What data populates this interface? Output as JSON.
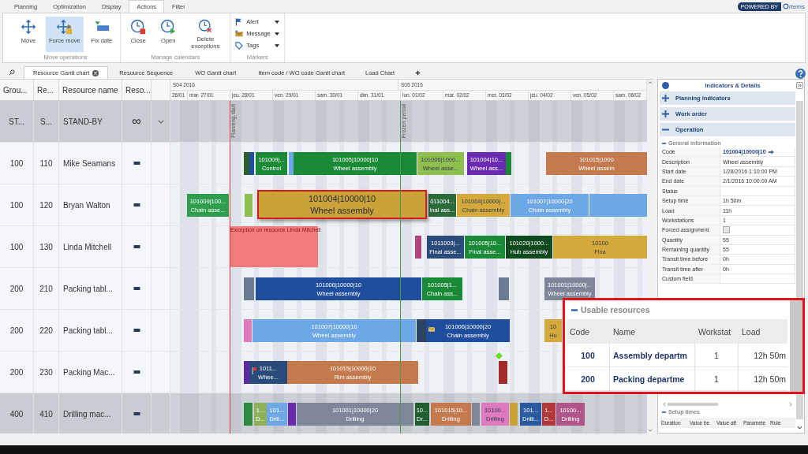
{
  "ribbon_tabs": [
    {
      "label": "Planning",
      "selected": false
    },
    {
      "label": "Optimization",
      "selected": false
    },
    {
      "label": "Display",
      "selected": false
    },
    {
      "label": "Actions",
      "selected": true
    },
    {
      "label": "Filter",
      "selected": false
    }
  ],
  "brand": {
    "tagline": "POWERED BY",
    "name": "rtems"
  },
  "ribbon_groups": [
    {
      "title": "Move operations",
      "kind": "large",
      "buttons": [
        {
          "label": "Move",
          "selected": false
        },
        {
          "label": "Force move",
          "selected": true
        },
        {
          "label": "Fix date",
          "selected": false
        }
      ]
    },
    {
      "title": "Manage calendars",
      "kind": "large",
      "buttons": [
        {
          "label": "Close",
          "selected": false
        },
        {
          "label": "Open",
          "selected": false
        },
        {
          "label": "Delete exceptions",
          "selected": false
        }
      ]
    },
    {
      "title": "Markers",
      "kind": "small",
      "buttons": [
        {
          "label": "Alert"
        },
        {
          "label": "Message"
        },
        {
          "label": "Tags"
        }
      ]
    }
  ],
  "doc_tabs": [
    {
      "label": "Resource Gantt chart",
      "selected": true
    },
    {
      "label": "Resource Sequence",
      "selected": false
    },
    {
      "label": "WO Gantt chart",
      "selected": false
    },
    {
      "label": "Item code / WO code Gantt chart",
      "selected": false
    },
    {
      "label": "Load Chart",
      "selected": false
    }
  ],
  "table": {
    "columns": [
      "Grou...",
      "Re...",
      "Resource name",
      "Reso..."
    ],
    "weeks": [
      "S04 2016",
      "S05 2016"
    ],
    "days": [
      "26/01",
      "mar. 27/01",
      "jeu. 28/01",
      "ven. 29/01",
      "sam. 30/01",
      "dim. 31/01",
      "lun. 01/02",
      "mar. 02/02",
      "mer. 03/02",
      "jeu. 04/02",
      "ven. 05/02",
      "sam. 06/02"
    ]
  },
  "time_markers": [
    {
      "label": "Planning start",
      "color": "#e03a3a"
    },
    {
      "label": "Frozen period",
      "color": "#4a9a4a"
    }
  ],
  "rows": [
    {
      "group": "ST...",
      "code": "S...",
      "name": "STAND-BY",
      "kind": "standby",
      "type": "∞",
      "shaded": true
    },
    {
      "group": "100",
      "code": "110",
      "name": "Mike Seamans",
      "kind": "resource",
      "shaded": false,
      "bars": [
        {
          "color": "#2e5e2e",
          "selected": false
        },
        {
          "color": "#1f4e9c",
          "selected": false
        },
        {
          "id": "101009|...",
          "op": "Control",
          "color": "#1a8a36",
          "selected": false
        },
        {
          "color": "#6ea7e6",
          "selected": false
        },
        {
          "id": "101005|10000|10",
          "op": "Wheel assembly",
          "color": "#1a8a36",
          "selected": false
        },
        {
          "id": "101006|1000...",
          "op": "Wheel asse...",
          "color": "#8fbf4f",
          "selected": false
        },
        {
          "id": "101004|10...",
          "op": "Wheel ass...",
          "color": "#6a2bb0",
          "selected": false
        },
        {
          "color": "#1a8a36",
          "selected": false
        },
        {
          "id": "101015|1000",
          "op": "Wheel assem",
          "color": "#c47a4e",
          "selected": false
        }
      ]
    },
    {
      "group": "100",
      "code": "120",
      "name": "Bryan Walton",
      "kind": "resource",
      "shaded": false,
      "bars": [
        {
          "id": "101009|100...",
          "op": "Chain asse...",
          "color": "#2e9e4e",
          "selected": false
        },
        {
          "color": "#8fbf4f",
          "selected": false
        },
        {
          "id": "101004|10000|10",
          "op": "Wheel assembly",
          "color": "#c9a23a",
          "selected": true
        },
        {
          "id": "011004...",
          "op": "inal ass...",
          "color": "#2e6b3a",
          "selected": false
        },
        {
          "id": "101004|10000|...",
          "op": "Chain assembly",
          "color": "#d4a83a",
          "selected": false
        },
        {
          "id": "101007|10000|20",
          "op": "Chain assembly",
          "color": "#6ea7e6",
          "selected": false
        },
        {
          "color": "#6ea7e6",
          "selected": false
        }
      ]
    },
    {
      "group": "100",
      "code": "130",
      "name": "Linda Mitchell",
      "kind": "resource",
      "shaded": false,
      "exception": "Exception on resource Linda Mitchell",
      "bars": [
        {
          "color": "#b0457a",
          "selected": false
        },
        {
          "id": "1011003|...",
          "op": "Final asse...",
          "color": "#2a4a7a",
          "selected": false
        },
        {
          "id": "101005|10...",
          "op": "Final asse...",
          "color": "#1a8a36",
          "selected": false
        },
        {
          "id": "101020|1000...",
          "op": "Hub assembly",
          "color": "#0f4a1f",
          "selected": false
        },
        {
          "id": "10100",
          "op": "Fina",
          "color": "#d4a83a",
          "selected": false
        }
      ]
    },
    {
      "group": "200",
      "code": "210",
      "name": "Packing tabl...",
      "kind": "resource",
      "shaded": false,
      "bars": [
        {
          "color": "#6d7c92",
          "selected": false
        },
        {
          "id": "101006|10000|10",
          "op": "Wheel assembly",
          "color": "#1f4e9c",
          "selected": false
        },
        {
          "id": "101005|1...",
          "op": "Chain ass...",
          "color": "#1a8a36",
          "selected": false
        },
        {
          "color": "#6d7c92",
          "selected": false
        },
        {
          "id": "101001|10000|...",
          "op": "Wheel assembly",
          "color": "#7d8799",
          "selected": false
        }
      ]
    },
    {
      "group": "200",
      "code": "220",
      "name": "Packing tabl...",
      "kind": "resource",
      "shaded": false,
      "bars": [
        {
          "color": "#e07ac0",
          "selected": false
        },
        {
          "id": "101007|10000|10",
          "op": "Wheel assembly",
          "color": "#6ea7e6",
          "selected": false
        },
        {
          "color": "#2e4463",
          "selected": false
        },
        {
          "id": "101006|10000|20",
          "op": "Chain assembly",
          "color": "#1f4e9c",
          "selected": false,
          "message": true
        },
        {
          "id": "10",
          "op": "Hu",
          "color": "#d4a83a",
          "selected": false
        }
      ]
    },
    {
      "group": "200",
      "code": "230",
      "name": "Packing Mac...",
      "kind": "resource",
      "shaded": false,
      "milestone": true,
      "bars": [
        {
          "color": "#5a2aa0",
          "selected": false
        },
        {
          "id": "1011...",
          "op": "Whee...",
          "color": "#2a4a7a",
          "selected": false,
          "flagged": true
        },
        {
          "id": "101015|10000|10",
          "op": "Rim assembly",
          "color": "#c47a4e",
          "selected": false
        },
        {
          "color": "#a52a2a",
          "selected": false
        }
      ]
    },
    {
      "group": "400",
      "code": "410",
      "name": "Drilling mac...",
      "kind": "resource",
      "shaded": true,
      "bars": [
        {
          "color": "#2e8a3e",
          "selected": false
        },
        {
          "id": "1...",
          "op": "D...",
          "color": "#8fb05a",
          "selected": false
        },
        {
          "id": "101...",
          "op": "Drill...",
          "color": "#6ea7e6",
          "selected": false
        },
        {
          "color": "#6a2bb0",
          "selected": false
        },
        {
          "id": "101001|10000|20",
          "op": "Drilling",
          "color": "#7d8799",
          "selected": false
        },
        {
          "id": "10...",
          "op": "Dr...",
          "color": "#1f5e2e",
          "selected": false
        },
        {
          "id": "101015|10...",
          "op": "Drilling",
          "color": "#c47a4e",
          "selected": false
        },
        {
          "color": "#7d8799",
          "selected": false
        },
        {
          "id": "10100...",
          "op": "Drilling",
          "color": "#e07ac0",
          "selected": false
        },
        {
          "color": "#c9a23a",
          "selected": false
        },
        {
          "id": "101...",
          "op": "Drilli...",
          "color": "#2a5aa0",
          "selected": false
        },
        {
          "id": "1...",
          "op": "D...",
          "color": "#b03a3a",
          "selected": false
        },
        {
          "id": "10100...",
          "op": "Drilling",
          "color": "#b0558a",
          "selected": false
        }
      ]
    }
  ],
  "details": {
    "title": "Indicators & Details",
    "sections": [
      {
        "label": "Planning indicators",
        "expanded": false
      },
      {
        "label": "Work order",
        "expanded": false
      },
      {
        "label": "Operation",
        "expanded": true
      }
    ],
    "group": "General information",
    "properties": [
      {
        "label": "Code",
        "kind": "link",
        "value": "101004|10000|10"
      },
      {
        "label": "Description",
        "kind": "text",
        "value": "Wheel assembly"
      },
      {
        "label": "Start date",
        "kind": "text",
        "value": "1/28/2016 1:10:00 PM"
      },
      {
        "label": "End date",
        "kind": "text",
        "value": "2/1/2016 10:00:00 AM"
      },
      {
        "label": "Status",
        "kind": "text"
      },
      {
        "label": "Setup time",
        "kind": "text",
        "value": "1h 50m"
      },
      {
        "label": "Load",
        "kind": "text",
        "value": "11h"
      },
      {
        "label": "Workstations",
        "kind": "text",
        "value": "1"
      },
      {
        "label": "Forced assignment",
        "kind": "checkbox",
        "checked": false
      },
      {
        "label": "Quantity",
        "kind": "text",
        "value": "55"
      },
      {
        "label": "Remaining quantity",
        "kind": "text",
        "value": "55"
      },
      {
        "label": "Transit time before",
        "kind": "text",
        "value": "0h"
      },
      {
        "label": "Transit time after",
        "kind": "text",
        "value": "0h"
      },
      {
        "label": "Custom field",
        "kind": "text"
      }
    ],
    "setup_times": {
      "title": "Setup times",
      "columns": [
        "Duration",
        "Value be",
        "Value aft",
        "Paramete",
        "Rule"
      ]
    }
  },
  "usable_resources": {
    "title": "Usable resources",
    "columns": [
      "Code",
      "Name",
      "Workstat",
      "Load"
    ],
    "rows": [
      [
        "100",
        "Assembly departm",
        "1",
        "12h 50m"
      ],
      [
        "200",
        "Packing departme",
        "1",
        "12h 50m"
      ]
    ]
  }
}
